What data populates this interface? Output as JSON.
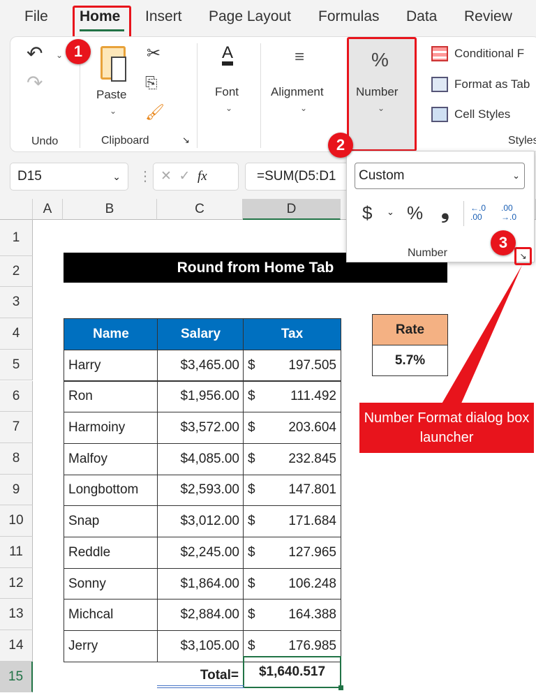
{
  "tabs": [
    "File",
    "Home",
    "Insert",
    "Page Layout",
    "Formulas",
    "Data",
    "Review"
  ],
  "active_tab": "Home",
  "ribbon": {
    "undo_group": "Undo",
    "paste": "Paste",
    "clipboard_group": "Clipboard",
    "font": "Font",
    "alignment": "Alignment",
    "number": "Number",
    "conditional": "Conditional F",
    "format_table": "Format as Tab",
    "cell_styles": "Cell Styles",
    "styles_group": "Styles"
  },
  "formula_bar": {
    "name_box": "D15",
    "formula": "=SUM(D5:D1"
  },
  "number_popup": {
    "format": "Custom",
    "group_label": "Number",
    "currency": "$",
    "percent": "%",
    "comma": "❟",
    "inc_decimal": "←.0 .00",
    "dec_decimal": ".00 →.0"
  },
  "columns": [
    "A",
    "B",
    "C",
    "D"
  ],
  "rows": [
    "1",
    "2",
    "3",
    "4",
    "5",
    "6",
    "7",
    "8",
    "9",
    "10",
    "11",
    "12",
    "13",
    "14",
    "15"
  ],
  "sheet": {
    "title": "Round from Home Tab",
    "headers": [
      "Name",
      "Salary",
      "Tax"
    ],
    "data": [
      [
        "Harry",
        "$3,465.00",
        "197.505"
      ],
      [
        "Ron",
        "$1,956.00",
        "111.492"
      ],
      [
        "Harmoiny",
        "$3,572.00",
        "203.604"
      ],
      [
        "Malfoy",
        "$4,085.00",
        "232.845"
      ],
      [
        "Longbottom",
        "$2,593.00",
        "147.801"
      ],
      [
        "Snap",
        "$3,012.00",
        "171.684"
      ],
      [
        "Reddle",
        "$2,245.00",
        "127.965"
      ],
      [
        "Sonny",
        "$1,864.00",
        "106.248"
      ],
      [
        "Michcal",
        "$2,884.00",
        "164.388"
      ],
      [
        "Jerry",
        "$3,105.00",
        "176.985"
      ]
    ],
    "currency_symbol": "$",
    "total_label": "Total=",
    "total_value": "$1,640.517",
    "rate_label": "Rate",
    "rate_value": "5.7%"
  },
  "annotations": {
    "step1": "1",
    "step2": "2",
    "step3": "3",
    "callout": "Number Format dialog box launcher"
  },
  "colors": {
    "accent_red": "#e8141c",
    "header_blue": "#0070c0",
    "rate_orange": "#f4b183",
    "excel_green": "#217346"
  }
}
